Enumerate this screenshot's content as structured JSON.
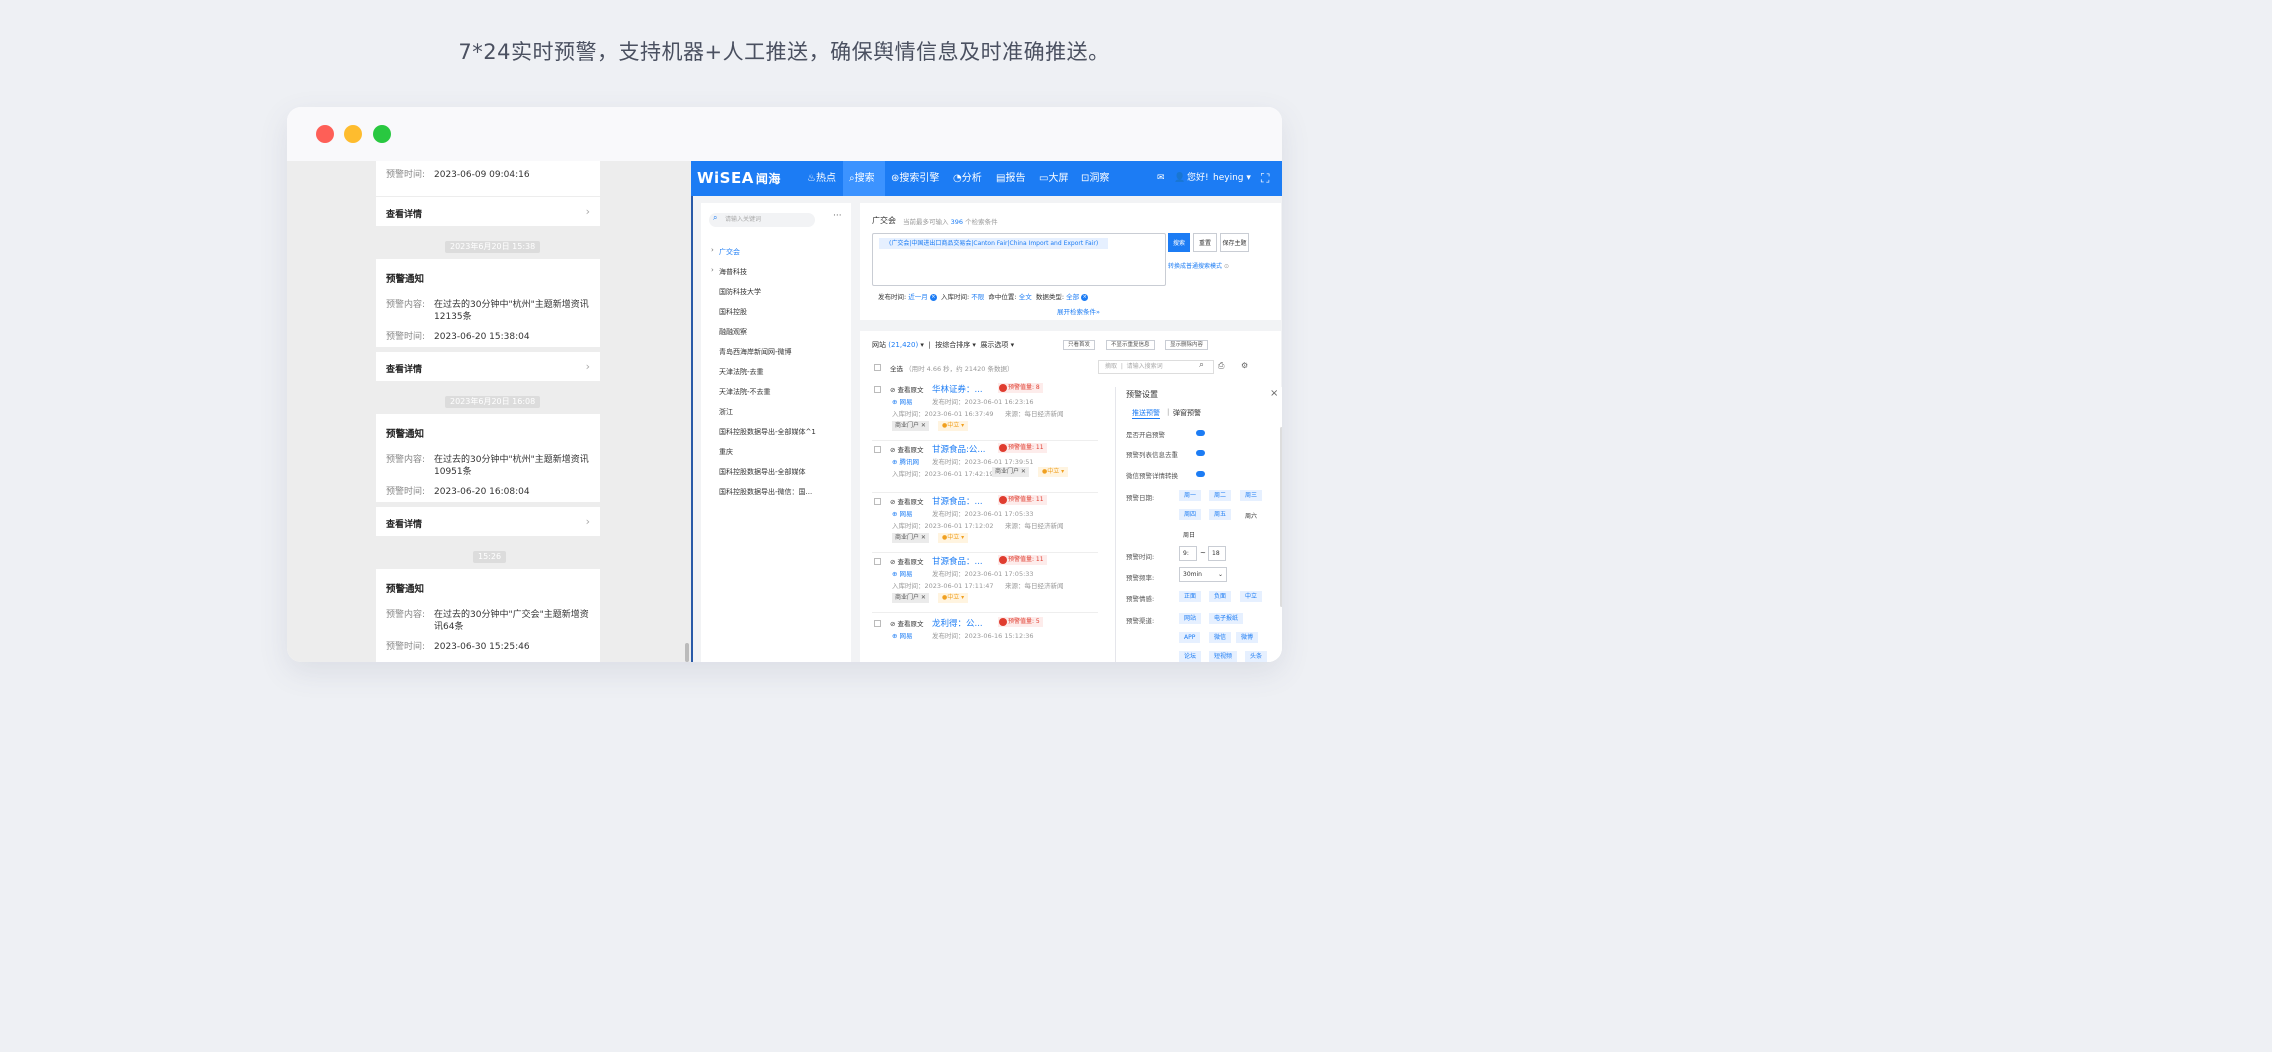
{
  "headline": "7*24实时预警，支持机器+人工推送，确保舆情信息及时准确推送。",
  "phone": {
    "cards": [
      {
        "title": "",
        "content_label": "",
        "content": "",
        "time_label": "预警时间:",
        "time": "2023-06-09 09:04:16",
        "detail": "查看详情"
      },
      {
        "timestamp": "2023年6月20日 15:38",
        "title": "预警通知",
        "content_label": "预警内容:",
        "content": "在过去的30分钟中\"杭州\"主题新增资讯12135条",
        "time_label": "预警时间:",
        "time": "2023-06-20 15:38:04",
        "detail": "查看详情"
      },
      {
        "timestamp": "2023年6月20日 16:08",
        "title": "预警通知",
        "content_label": "预警内容:",
        "content": "在过去的30分钟中\"杭州\"主题新增资讯10951条",
        "time_label": "预警时间:",
        "time": "2023-06-20 16:08:04",
        "detail": "查看详情"
      },
      {
        "timestamp": "15:26",
        "title": "预警通知",
        "content_label": "预警内容:",
        "content": "在过去的30分钟中\"广交会\"主题新增资讯64条",
        "time_label": "预警时间:",
        "time": "2023-06-30 15:25:46"
      }
    ]
  },
  "app": {
    "logo": "WiSEA",
    "logo_cn": "闻海",
    "nav": [
      "热点",
      "搜索",
      "搜索引擎",
      "分析",
      "报告",
      "大屏",
      "洞察"
    ],
    "greeting": "您好!",
    "user": "heying",
    "sidebar": {
      "search_placeholder": "请输入关键词",
      "more": "···",
      "items": [
        "广交会",
        "海普科技",
        "国防科技大学",
        "国科控股",
        "融融观察",
        "青岛西海岸新闻网-微博",
        "天津法院-去重",
        "天津法院-不去重",
        "浙江",
        "国科控股数据导出-全部媒体^1",
        "重庆",
        "国科控股数据导出-全部媒体",
        "国科控股数据导出-微信：国..."
      ]
    },
    "query": {
      "title": "广交会",
      "hint_prefix": "当前最多可输入",
      "hint_count": "396",
      "hint_suffix": "个检索条件",
      "tag": "(广交会|中国进出口商品交易会|Canton Fair|China Import and Export Fair)",
      "btn_search": "搜索",
      "btn_reset": "重置",
      "btn_save": "保存主题",
      "switch_mode": "转换成普通搜索模式",
      "filters": [
        {
          "label": "发布时间:",
          "value": "近一月"
        },
        {
          "label": "入库时间:",
          "value": "不限"
        },
        {
          "label": "命中位置:",
          "value": "全文"
        },
        {
          "label": "数据类型:",
          "value": "全部"
        }
      ],
      "expand": "展开检索条件"
    },
    "results": {
      "source": "网站",
      "count": "(21,420)",
      "sort": "按综合排序",
      "display": "展示选项",
      "btn_unread": "只看首发",
      "btn_hide_dup": "不显示重复信息",
      "btn_deleted": "显示删除内容",
      "select_all": "全选",
      "summary": "（用时 4.66 秒，约 21420 条数据）",
      "search_scope": "摘取",
      "search_placeholder": "请输入搜索词",
      "entries": [
        {
          "source_link": "查看原文",
          "title": "华林证券：...",
          "badge": "预警值量: 8",
          "site": "网易",
          "pub": "发布时间：2023-06-01 16:23:16",
          "ingest": "入库时间：2023-06-01 16:37:49",
          "from": "来源：每日经济新闻",
          "tag1": "商业门户",
          "tag2": "中立"
        },
        {
          "source_link": "查看原文",
          "title": "甘源食品:公...",
          "badge": "预警值量: 11",
          "site": "腾讯网",
          "pub": "发布时间：2023-06-01 17:39:51",
          "ingest": "入库时间：2023-06-01 17:42:19",
          "from": "",
          "tag1": "商业门户",
          "tag2": "中立"
        },
        {
          "source_link": "查看原文",
          "title": "甘源食品：...",
          "badge": "预警值量: 11",
          "site": "网易",
          "pub": "发布时间：2023-06-01 17:05:33",
          "ingest": "入库时间：2023-06-01 17:12:02",
          "from": "来源：每日经济新闻",
          "tag1": "商业门户",
          "tag2": "中立"
        },
        {
          "source_link": "查看原文",
          "title": "甘源食品：...",
          "badge": "预警值量: 11",
          "site": "网易",
          "pub": "发布时间：2023-06-01 17:05:33",
          "ingest": "入库时间：2023-06-01 17:11:47",
          "from": "来源：每日经济新闻",
          "tag1": "商业门户",
          "tag2": "中立"
        },
        {
          "source_link": "查看原文",
          "title": "龙利得：公...",
          "badge": "预警值量: 5",
          "site": "网易",
          "pub": "发布时间：2023-06-16 15:12:36"
        }
      ]
    },
    "alert_panel": {
      "title": "预警设置",
      "close": "×",
      "tab_push": "推送预警",
      "tab_popup": "弹窗预警",
      "toggles": [
        "是否开启预警",
        "预警列表信息去重",
        "微信预警详情转换"
      ],
      "day_label": "预警日期:",
      "days_selected": [
        "周一",
        "周二",
        "周三",
        "周四",
        "周五"
      ],
      "days_plain": [
        "周六",
        "周日"
      ],
      "time_label": "预警时间:",
      "time_from": "9:",
      "time_sep": "~",
      "time_to": "18",
      "freq_label": "预警频率:",
      "freq_value": "30min",
      "sentiment_label": "预警情感:",
      "sentiments": [
        "正面",
        "负面",
        "中立"
      ],
      "channel_label": "预警渠道:",
      "channels": [
        "网站",
        "电子报纸",
        "APP",
        "微信",
        "微博",
        "论坛",
        "短视频",
        "头条"
      ]
    }
  }
}
